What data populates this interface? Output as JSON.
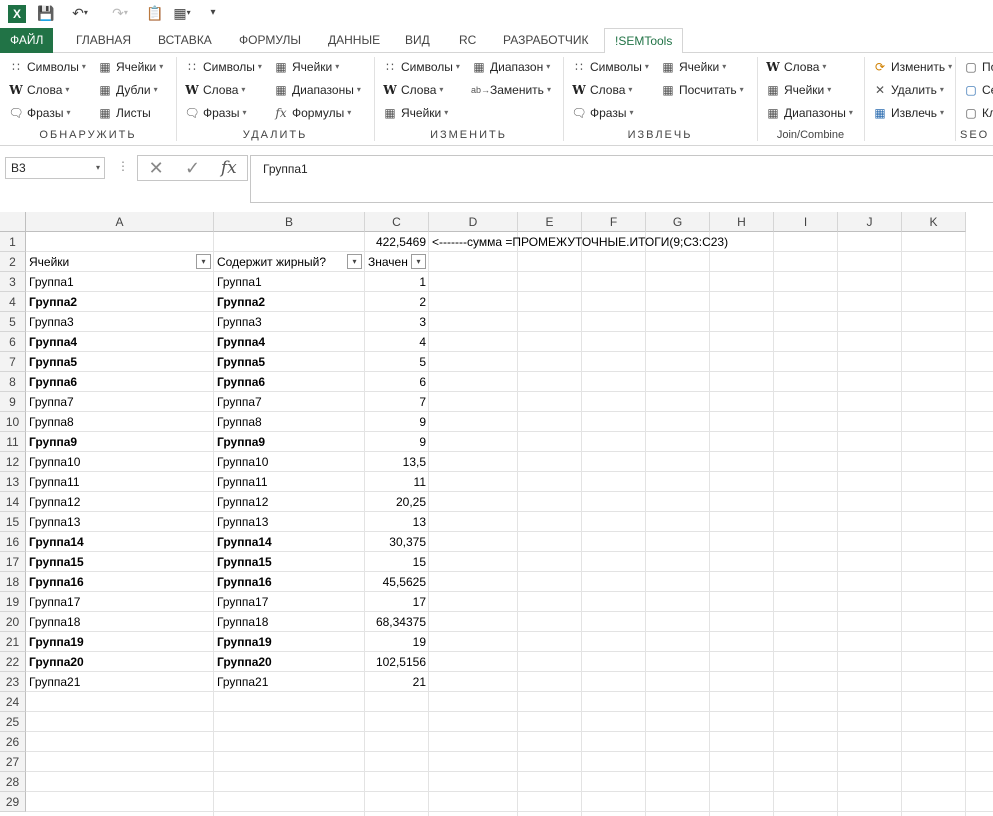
{
  "tabs": [
    "ФАЙЛ",
    "ГЛАВНАЯ",
    "ВСТАВКА",
    "ФОРМУЛЫ",
    "ДАННЫЕ",
    "ВИД",
    "RC",
    "РАЗРАБОТЧИК",
    "!SEMTools"
  ],
  "ribbon": {
    "groups": [
      {
        "label": "ОБНАРУЖИТЬ",
        "items": [
          "Символы",
          "Ячейки",
          "Слова",
          "Дубли",
          "Фразы",
          "Листы"
        ]
      },
      {
        "label": "УДАЛИТЬ",
        "items": [
          "Символы",
          "Ячейки",
          "Слова",
          "Диапазоны",
          "Фразы",
          "Формулы"
        ]
      },
      {
        "label": "ИЗМЕНИТЬ",
        "items": [
          "Символы",
          "Диапазон",
          "Слова",
          "Заменить",
          "Ячейки"
        ]
      },
      {
        "label": "ИЗВЛЕЧЬ",
        "items": [
          "Символы",
          "Ячейки",
          "Слова",
          "Посчитать",
          "Фразы"
        ]
      },
      {
        "label": "Join/Combine",
        "items": [
          "Слова",
          "Ячейки",
          "Диапазоны"
        ]
      },
      {
        "label": "",
        "items": [
          "Изменить",
          "Удалить",
          "Извлечь"
        ]
      },
      {
        "label": "SEO",
        "items": [
          "По",
          "Се",
          "Кл"
        ]
      }
    ]
  },
  "formula_bar": {
    "name_box": "B3",
    "formula": "Группа1",
    "fx_label": "fx"
  },
  "columns": [
    "A",
    "B",
    "C",
    "D",
    "E",
    "F",
    "G",
    "H",
    "I",
    "J",
    "K"
  ],
  "rows": [
    "1",
    "2",
    "3",
    "4",
    "5",
    "6",
    "7",
    "8",
    "9",
    "10",
    "11",
    "12",
    "13",
    "14",
    "15",
    "16",
    "17",
    "18",
    "19",
    "20",
    "21",
    "22",
    "23",
    "24",
    "25",
    "26",
    "27",
    "28",
    "29"
  ],
  "sheet": {
    "c1": "422,5469",
    "d1": "<-------сумма =ПРОМЕЖУТОЧНЫЕ.ИТОГИ(9;C3:C23)",
    "headers": [
      "Ячейки",
      "Содержит жирный?",
      "Значен"
    ],
    "data": [
      {
        "a": "Группа1",
        "b": "Группа1",
        "c": "1",
        "bold": false
      },
      {
        "a": "Группа2",
        "b": "Группа2",
        "c": "2",
        "bold": true
      },
      {
        "a": "Группа3",
        "b": "Группа3",
        "c": "3",
        "bold": false
      },
      {
        "a": "Группа4",
        "b": "Группа4",
        "c": "4",
        "bold": true
      },
      {
        "a": "Группа5",
        "b": "Группа5",
        "c": "5",
        "bold": true
      },
      {
        "a": "Группа6",
        "b": "Группа6",
        "c": "6",
        "bold": true
      },
      {
        "a": "Группа7",
        "b": "Группа7",
        "c": "7",
        "bold": false
      },
      {
        "a": "Группа8",
        "b": "Группа8",
        "c": "9",
        "bold": false
      },
      {
        "a": "Группа9",
        "b": "Группа9",
        "c": "9",
        "bold": true
      },
      {
        "a": "Группа10",
        "b": "Группа10",
        "c": "13,5",
        "bold": false
      },
      {
        "a": "Группа11",
        "b": "Группа11",
        "c": "11",
        "bold": false
      },
      {
        "a": "Группа12",
        "b": "Группа12",
        "c": "20,25",
        "bold": false
      },
      {
        "a": "Группа13",
        "b": "Группа13",
        "c": "13",
        "bold": false
      },
      {
        "a": "Группа14",
        "b": "Группа14",
        "c": "30,375",
        "bold": true
      },
      {
        "a": "Группа15",
        "b": "Группа15",
        "c": "15",
        "bold": true
      },
      {
        "a": "Группа16",
        "b": "Группа16",
        "c": "45,5625",
        "bold": true
      },
      {
        "a": "Группа17",
        "b": "Группа17",
        "c": "17",
        "bold": false
      },
      {
        "a": "Группа18",
        "b": "Группа18",
        "c": "68,34375",
        "bold": false
      },
      {
        "a": "Группа19",
        "b": "Группа19",
        "c": "19",
        "bold": true
      },
      {
        "a": "Группа20",
        "b": "Группа20",
        "c": "102,5156",
        "bold": true
      },
      {
        "a": "Группа21",
        "b": "Группа21",
        "c": "21",
        "bold": false
      }
    ]
  },
  "colors": {
    "accent": "#217346",
    "file_tab": "#217346",
    "header_bg": "#f3f3f3",
    "excel_logo": "#1e7145"
  }
}
